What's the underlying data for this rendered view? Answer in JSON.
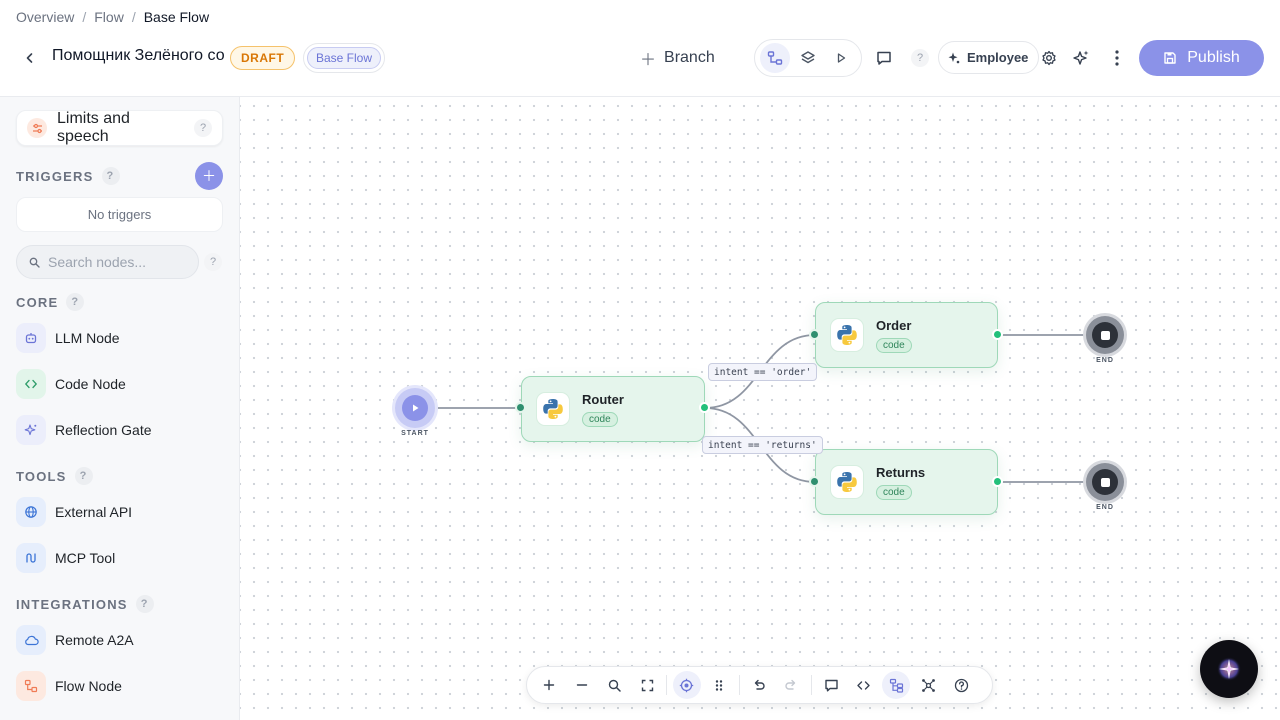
{
  "header": {
    "breadcrumb": [
      "Overview",
      "Flow",
      "Base Flow"
    ],
    "flow_title": "Помощник Зелёного со",
    "status_badge": "DRAFT",
    "flow_badge": "Base Flow",
    "branch_label": "Branch",
    "employee_label": "Employee",
    "publish_label": "Publish",
    "help_glyph": "?"
  },
  "sidebar": {
    "limits_label": "Limits and speech",
    "triggers_header": "TRIGGERS",
    "no_triggers": "No triggers",
    "search_placeholder": "Search nodes...",
    "core_header": "CORE",
    "core_items": [
      {
        "label": "LLM Node",
        "icon": "robot-icon"
      },
      {
        "label": "Code Node",
        "icon": "code-icon"
      },
      {
        "label": "Reflection Gate",
        "icon": "sparkles-icon"
      }
    ],
    "tools_header": "TOOLS",
    "tools_items": [
      {
        "label": "External API",
        "icon": "globe-icon"
      },
      {
        "label": "MCP Tool",
        "icon": "mcp-icon"
      }
    ],
    "integrations_header": "INTEGRATIONS",
    "integrations_items": [
      {
        "label": "Remote A2A",
        "icon": "cloud-icon"
      },
      {
        "label": "Flow Node",
        "icon": "flow-icon"
      }
    ]
  },
  "canvas": {
    "start_caption": "START",
    "end_caption": "END",
    "nodes": [
      {
        "id": "router",
        "title": "Router",
        "tag": "code"
      },
      {
        "id": "order",
        "title": "Order",
        "tag": "code"
      },
      {
        "id": "returns",
        "title": "Returns",
        "tag": "code"
      }
    ],
    "edge_labels": [
      "intent == 'order'",
      "intent == 'returns'"
    ]
  },
  "colors": {
    "accent": "#8b92e8",
    "node_fill": "#e5f5ec",
    "node_border": "#9ed8b8",
    "draft": "#d97706"
  }
}
